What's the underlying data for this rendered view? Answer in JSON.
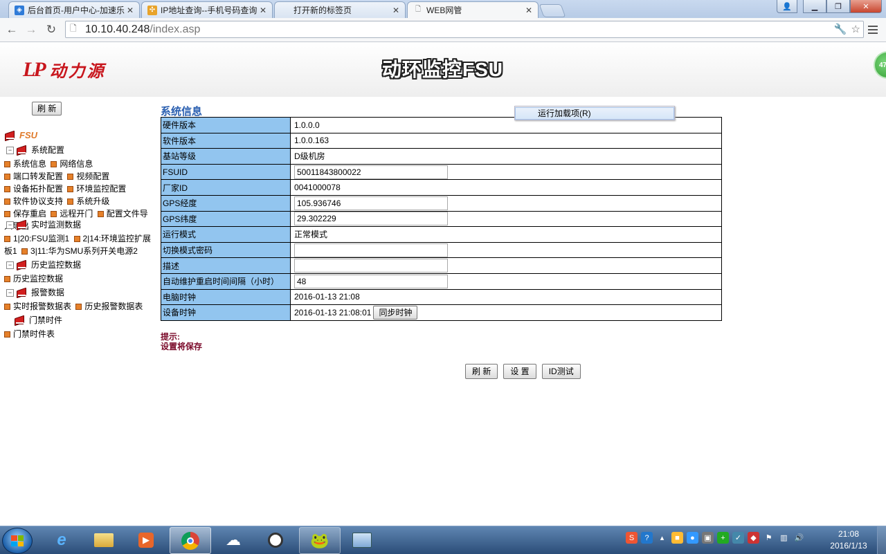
{
  "browser": {
    "tabs": [
      {
        "title": "后台首页-用户中心-加速乐",
        "icon": "site-icon"
      },
      {
        "title": "IP地址查询--手机号码查询",
        "icon": "ip-site-icon"
      },
      {
        "title": "打开新的标签页",
        "icon": "none"
      },
      {
        "title": "WEB网管",
        "icon": "page-icon"
      }
    ],
    "url_host": "10.10.40.248",
    "url_path": "/index.asp"
  },
  "header": {
    "logo_mark": "LP",
    "logo_text": "动力源",
    "system_title": "动环监控FSU",
    "badge": "47"
  },
  "sidebar": {
    "refresh_label": "刷 新",
    "root_label": "FSU",
    "groups": [
      {
        "label": "系统配置"
      },
      {
        "label": "实时监测数据"
      },
      {
        "label": "历史监控数据"
      },
      {
        "label": "报警数据"
      },
      {
        "label": "门禁时件"
      }
    ],
    "system_items": [
      "系统信息",
      "网络信息",
      "端口转发配置",
      "视频配置",
      "设备拓扑配置",
      "环境监控配置",
      "软件协议支持",
      "系统升级",
      "保存重启",
      "远程开门",
      "配置文件导入导出"
    ],
    "realtime_items": [
      "1|20:FSU监测1",
      "2|14:环境监控扩展板1",
      "3|11:华为SMU系列开关电源2"
    ],
    "history_items": [
      "历史监控数据"
    ],
    "alarm_items": [
      "实时报警数据表",
      "历史报警数据表"
    ],
    "door_items": [
      "门禁时件表"
    ]
  },
  "main": {
    "section_title": "系统信息",
    "context_menu_item": "运行加载项(R)",
    "rows": [
      {
        "label": "硬件版本",
        "value": "1.0.0.0",
        "type": "text"
      },
      {
        "label": "软件版本",
        "value": "1.0.0.163",
        "type": "text"
      },
      {
        "label": "基站等级",
        "value": "D级机房",
        "type": "text"
      },
      {
        "label": "FSUID",
        "value": "50011843800022",
        "type": "input"
      },
      {
        "label": "厂家ID",
        "value": "0041000078",
        "type": "text"
      },
      {
        "label": "GPS经度",
        "value": "105.936746",
        "type": "input"
      },
      {
        "label": "GPS纬度",
        "value": "29.302229",
        "type": "input"
      },
      {
        "label": "运行模式",
        "value": "正常模式",
        "type": "text"
      },
      {
        "label": "切换模式密码",
        "value": "",
        "type": "input"
      },
      {
        "label": "描述",
        "value": "",
        "type": "input"
      },
      {
        "label": "自动维护重启时间间隔（小时）",
        "value": "48",
        "type": "input"
      },
      {
        "label": "电脑时钟",
        "value": "2016-01-13 21:08",
        "type": "text"
      },
      {
        "label": "设备时钟",
        "value": "2016-01-13 21:08:01",
        "type": "text"
      }
    ],
    "sync_clock_label": "同步时钟",
    "tip_title": "提示:",
    "tip_text": "设置将保存",
    "buttons": {
      "refresh": "刷 新",
      "set": "设 置",
      "id_test": "ID测试"
    }
  },
  "taskbar": {
    "apps": [
      "start",
      "ie-icon",
      "explorer-icon",
      "media-player-icon",
      "chrome-icon",
      "baidu-cloud-icon",
      "qq-browser-icon",
      "game-icon",
      "remote-desktop-icon"
    ],
    "time": "21:08",
    "date": "2016/1/13"
  }
}
